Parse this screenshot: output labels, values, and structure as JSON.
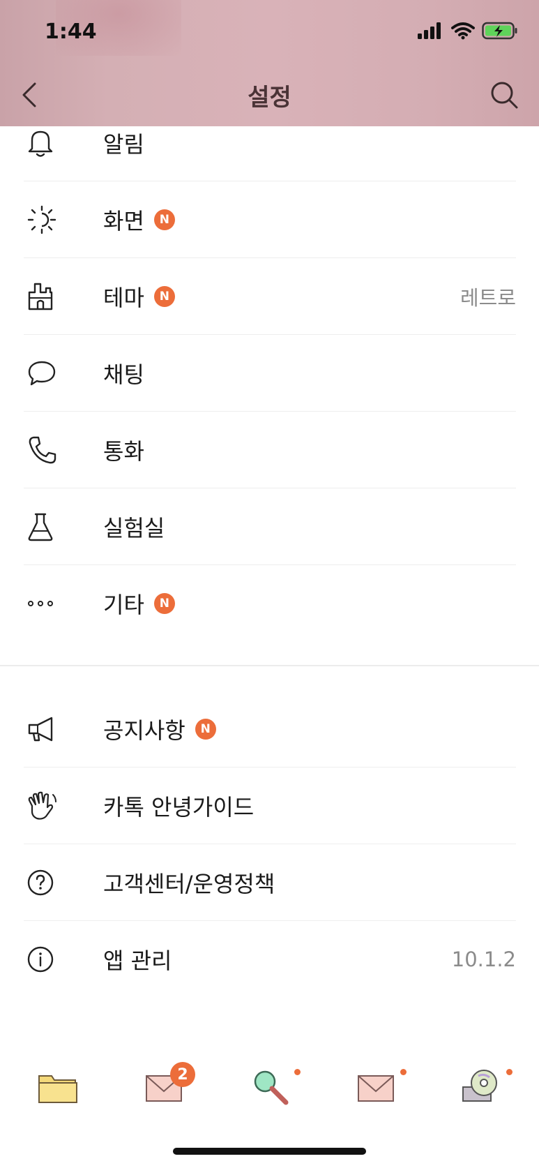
{
  "status_bar": {
    "time": "1:44"
  },
  "nav": {
    "title": "설정"
  },
  "settings_group_1": [
    {
      "label": "알림",
      "icon": "bell-icon",
      "badge": "",
      "value": ""
    },
    {
      "label": "화면",
      "icon": "brightness-icon",
      "badge": "N",
      "value": ""
    },
    {
      "label": "테마",
      "icon": "theme-brush-icon",
      "badge": "N",
      "value": "레트로"
    },
    {
      "label": "채팅",
      "icon": "chat-bubble-icon",
      "badge": "",
      "value": ""
    },
    {
      "label": "통화",
      "icon": "phone-icon",
      "badge": "",
      "value": ""
    },
    {
      "label": "실험실",
      "icon": "flask-icon",
      "badge": "",
      "value": ""
    },
    {
      "label": "기타",
      "icon": "more-dots-icon",
      "badge": "N",
      "value": ""
    }
  ],
  "settings_group_2": [
    {
      "label": "공지사항",
      "icon": "megaphone-icon",
      "badge": "N",
      "value": ""
    },
    {
      "label": "카톡 안녕가이드",
      "icon": "waving-hand-icon",
      "badge": "",
      "value": ""
    },
    {
      "label": "고객센터/운영정책",
      "icon": "help-circle-icon",
      "badge": "",
      "value": ""
    },
    {
      "label": "앱 관리",
      "icon": "info-circle-icon",
      "badge": "",
      "value": "10.1.2"
    }
  ],
  "tab_bar": {
    "tabs": [
      {
        "icon": "folder-icon",
        "badge": ""
      },
      {
        "icon": "envelope-icon",
        "badge": "2"
      },
      {
        "icon": "magnifier-icon",
        "badge": "dot"
      },
      {
        "icon": "envelope-icon",
        "badge": "dot"
      },
      {
        "icon": "cd-drive-icon",
        "badge": "dot"
      }
    ]
  },
  "colors": {
    "accent": "#ec6d3a",
    "header_bg": "#d4afb4"
  }
}
